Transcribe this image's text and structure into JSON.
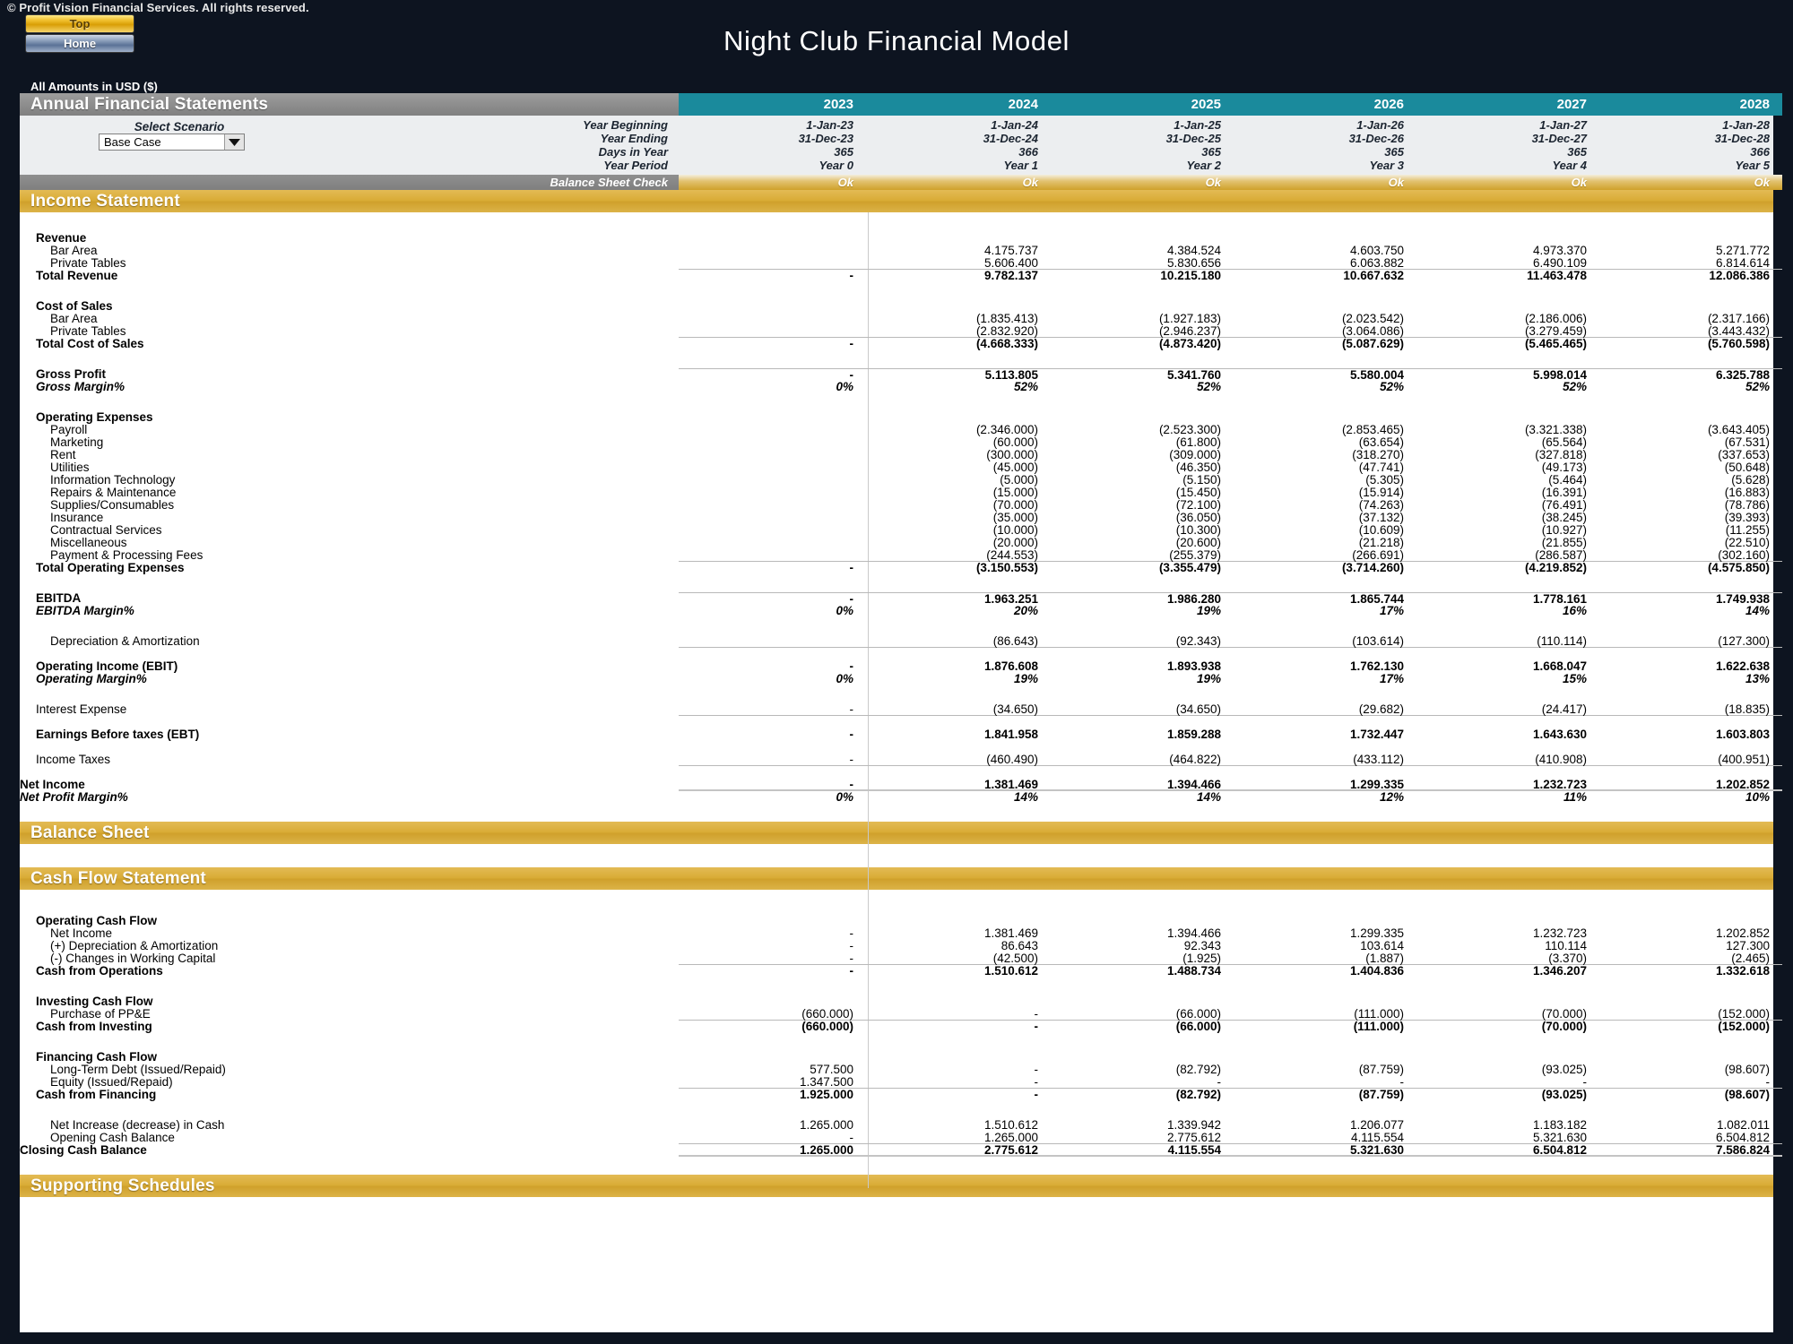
{
  "header": {
    "copyright": "© Profit Vision Financial Services. All rights reserved.",
    "btn_top": "Top",
    "btn_home": "Home",
    "doc_title": "Night Club Financial Model",
    "amounts_note": "All Amounts in  USD ($)"
  },
  "sheet": {
    "section_title": "Annual Financial Statements",
    "scenario_caption": "Select Scenario",
    "scenario_value": "Base Case",
    "meta_rows": [
      {
        "label": "Year Beginning",
        "values": [
          "1-Jan-23",
          "1-Jan-24",
          "1-Jan-25",
          "1-Jan-26",
          "1-Jan-27",
          "1-Jan-28"
        ]
      },
      {
        "label": "Year Ending",
        "values": [
          "31-Dec-23",
          "31-Dec-24",
          "31-Dec-25",
          "31-Dec-26",
          "31-Dec-27",
          "31-Dec-28"
        ]
      },
      {
        "label": "Days in Year",
        "values": [
          "365",
          "366",
          "365",
          "365",
          "365",
          "366"
        ]
      },
      {
        "label": "Year Period",
        "values": [
          "Year 0",
          "Year 1",
          "Year 2",
          "Year 3",
          "Year 4",
          "Year 5"
        ]
      }
    ],
    "years": [
      "2023",
      "2024",
      "2025",
      "2026",
      "2027",
      "2028"
    ],
    "balance_check": {
      "label": "Balance Sheet Check",
      "values": [
        "Ok",
        "Ok",
        "Ok",
        "Ok",
        "Ok",
        "Ok"
      ]
    },
    "sections": {
      "income_statement": "Income Statement",
      "balance_sheet": "Balance Sheet",
      "cash_flow": "Cash Flow Statement",
      "supporting": "Supporting Schedules"
    }
  },
  "colors": {
    "accent_teal": "#1a8a9c",
    "accent_gold": "#d9ab35",
    "dark_bg": "#0d1420",
    "margin_label": "#1f7f94"
  },
  "income_statement": {
    "revenue_header": "Revenue",
    "revenue_lines": [
      {
        "label": "Bar Area",
        "values": [
          "",
          "4.175.737",
          "4.384.524",
          "4.603.750",
          "4.973.370",
          "5.271.772"
        ]
      },
      {
        "label": "Private Tables",
        "values": [
          "",
          "5.606.400",
          "5.830.656",
          "6.063.882",
          "6.490.109",
          "6.814.614"
        ]
      }
    ],
    "total_revenue": {
      "label": "Total Revenue",
      "values": [
        "-",
        "9.782.137",
        "10.215.180",
        "10.667.632",
        "11.463.478",
        "12.086.386"
      ]
    },
    "cos_header": "Cost of Sales",
    "cos_lines": [
      {
        "label": "Bar Area",
        "values": [
          "",
          "(1.835.413)",
          "(1.927.183)",
          "(2.023.542)",
          "(2.186.006)",
          "(2.317.166)"
        ]
      },
      {
        "label": "Private Tables",
        "values": [
          "",
          "(2.832.920)",
          "(2.946.237)",
          "(3.064.086)",
          "(3.279.459)",
          "(3.443.432)"
        ]
      }
    ],
    "total_cos": {
      "label": "Total Cost of Sales",
      "values": [
        "-",
        "(4.668.333)",
        "(4.873.420)",
        "(5.087.629)",
        "(5.465.465)",
        "(5.760.598)"
      ]
    },
    "gross_profit": {
      "label": "Gross Profit",
      "values": [
        "-",
        "5.113.805",
        "5.341.760",
        "5.580.004",
        "5.998.014",
        "6.325.788"
      ]
    },
    "gross_margin": {
      "label": "Gross Margin%",
      "values": [
        "0%",
        "52%",
        "52%",
        "52%",
        "52%",
        "52%"
      ]
    },
    "opex_header": "Operating Expenses",
    "opex_lines": [
      {
        "label": "Payroll",
        "values": [
          "",
          "(2.346.000)",
          "(2.523.300)",
          "(2.853.465)",
          "(3.321.338)",
          "(3.643.405)"
        ]
      },
      {
        "label": "Marketing",
        "values": [
          "",
          "(60.000)",
          "(61.800)",
          "(63.654)",
          "(65.564)",
          "(67.531)"
        ]
      },
      {
        "label": "Rent",
        "values": [
          "",
          "(300.000)",
          "(309.000)",
          "(318.270)",
          "(327.818)",
          "(337.653)"
        ]
      },
      {
        "label": "Utilities",
        "values": [
          "",
          "(45.000)",
          "(46.350)",
          "(47.741)",
          "(49.173)",
          "(50.648)"
        ]
      },
      {
        "label": "Information Technology",
        "values": [
          "",
          "(5.000)",
          "(5.150)",
          "(5.305)",
          "(5.464)",
          "(5.628)"
        ]
      },
      {
        "label": "Repairs & Maintenance",
        "values": [
          "",
          "(15.000)",
          "(15.450)",
          "(15.914)",
          "(16.391)",
          "(16.883)"
        ]
      },
      {
        "label": "Supplies/Consumables",
        "values": [
          "",
          "(70.000)",
          "(72.100)",
          "(74.263)",
          "(76.491)",
          "(78.786)"
        ]
      },
      {
        "label": "Insurance",
        "values": [
          "",
          "(35.000)",
          "(36.050)",
          "(37.132)",
          "(38.245)",
          "(39.393)"
        ]
      },
      {
        "label": "Contractual Services",
        "values": [
          "",
          "(10.000)",
          "(10.300)",
          "(10.609)",
          "(10.927)",
          "(11.255)"
        ]
      },
      {
        "label": "Miscellaneous",
        "values": [
          "",
          "(20.000)",
          "(20.600)",
          "(21.218)",
          "(21.855)",
          "(22.510)"
        ]
      },
      {
        "label": "Payment & Processing Fees",
        "values": [
          "",
          "(244.553)",
          "(255.379)",
          "(266.691)",
          "(286.587)",
          "(302.160)"
        ]
      }
    ],
    "total_opex": {
      "label": "Total Operating Expenses",
      "values": [
        "-",
        "(3.150.553)",
        "(3.355.479)",
        "(3.714.260)",
        "(4.219.852)",
        "(4.575.850)"
      ]
    },
    "ebitda": {
      "label": "EBITDA",
      "values": [
        "-",
        "1.963.251",
        "1.986.280",
        "1.865.744",
        "1.778.161",
        "1.749.938"
      ]
    },
    "ebitda_margin": {
      "label": "EBITDA Margin%",
      "values": [
        "0%",
        "20%",
        "19%",
        "17%",
        "16%",
        "14%"
      ]
    },
    "depreciation": {
      "label": "Depreciation & Amortization",
      "values": [
        "",
        "(86.643)",
        "(92.343)",
        "(103.614)",
        "(110.114)",
        "(127.300)"
      ]
    },
    "ebit": {
      "label": "Operating Income (EBIT)",
      "values": [
        "-",
        "1.876.608",
        "1.893.938",
        "1.762.130",
        "1.668.047",
        "1.622.638"
      ]
    },
    "operating_margin": {
      "label": "Operating Margin%",
      "values": [
        "0%",
        "19%",
        "19%",
        "17%",
        "15%",
        "13%"
      ]
    },
    "interest": {
      "label": "Interest Expense",
      "values": [
        "-",
        "(34.650)",
        "(34.650)",
        "(29.682)",
        "(24.417)",
        "(18.835)"
      ]
    },
    "ebt": {
      "label": "Earnings Before taxes (EBT)",
      "values": [
        "-",
        "1.841.958",
        "1.859.288",
        "1.732.447",
        "1.643.630",
        "1.603.803"
      ]
    },
    "taxes": {
      "label": "Income Taxes",
      "values": [
        "-",
        "(460.490)",
        "(464.822)",
        "(433.112)",
        "(410.908)",
        "(400.951)"
      ]
    },
    "net_income": {
      "label": "Net Income",
      "values": [
        "-",
        "1.381.469",
        "1.394.466",
        "1.299.335",
        "1.232.723",
        "1.202.852"
      ]
    },
    "net_margin": {
      "label": "Net Profit Margin%",
      "values": [
        "0%",
        "14%",
        "14%",
        "12%",
        "11%",
        "10%"
      ]
    }
  },
  "cash_flow": {
    "operating_header": "Operating Cash Flow",
    "operating_lines": [
      {
        "label": "Net Income",
        "values": [
          "-",
          "1.381.469",
          "1.394.466",
          "1.299.335",
          "1.232.723",
          "1.202.852"
        ]
      },
      {
        "label": "(+) Depreciation & Amortization",
        "values": [
          "-",
          "86.643",
          "92.343",
          "103.614",
          "110.114",
          "127.300"
        ]
      },
      {
        "label": "(-) Changes in Working Capital",
        "values": [
          "-",
          "(42.500)",
          "(1.925)",
          "(1.887)",
          "(3.370)",
          "(2.465)"
        ]
      }
    ],
    "cash_from_operations": {
      "label": "Cash from Operations",
      "values": [
        "-",
        "1.510.612",
        "1.488.734",
        "1.404.836",
        "1.346.207",
        "1.332.618"
      ]
    },
    "investing_header": "Investing Cash Flow",
    "investing_lines": [
      {
        "label": "Purchase of PP&E",
        "values": [
          "(660.000)",
          "-",
          "(66.000)",
          "(111.000)",
          "(70.000)",
          "(152.000)"
        ]
      }
    ],
    "cash_from_investing": {
      "label": "Cash from Investing",
      "values": [
        "(660.000)",
        "-",
        "(66.000)",
        "(111.000)",
        "(70.000)",
        "(152.000)"
      ]
    },
    "financing_header": "Financing Cash Flow",
    "financing_lines": [
      {
        "label": "Long-Term Debt (Issued/Repaid)",
        "values": [
          "577.500",
          "-",
          "(82.792)",
          "(87.759)",
          "(93.025)",
          "(98.607)"
        ]
      },
      {
        "label": "Equity (Issued/Repaid)",
        "values": [
          "1.347.500",
          "-",
          "-",
          "-",
          "-",
          "-"
        ]
      }
    ],
    "cash_from_financing": {
      "label": "Cash from Financing",
      "values": [
        "1.925.000",
        "-",
        "(82.792)",
        "(87.759)",
        "(93.025)",
        "(98.607)"
      ]
    },
    "net_increase": {
      "label": "Net Increase (decrease) in Cash",
      "values": [
        "1.265.000",
        "1.510.612",
        "1.339.942",
        "1.206.077",
        "1.183.182",
        "1.082.011"
      ]
    },
    "opening_cash": {
      "label": "Opening Cash Balance",
      "values": [
        "-",
        "1.265.000",
        "2.775.612",
        "4.115.554",
        "5.321.630",
        "6.504.812"
      ]
    },
    "closing_cash": {
      "label": "Closing Cash Balance",
      "values": [
        "1.265.000",
        "2.775.612",
        "4.115.554",
        "5.321.630",
        "6.504.812",
        "7.586.824"
      ]
    }
  }
}
